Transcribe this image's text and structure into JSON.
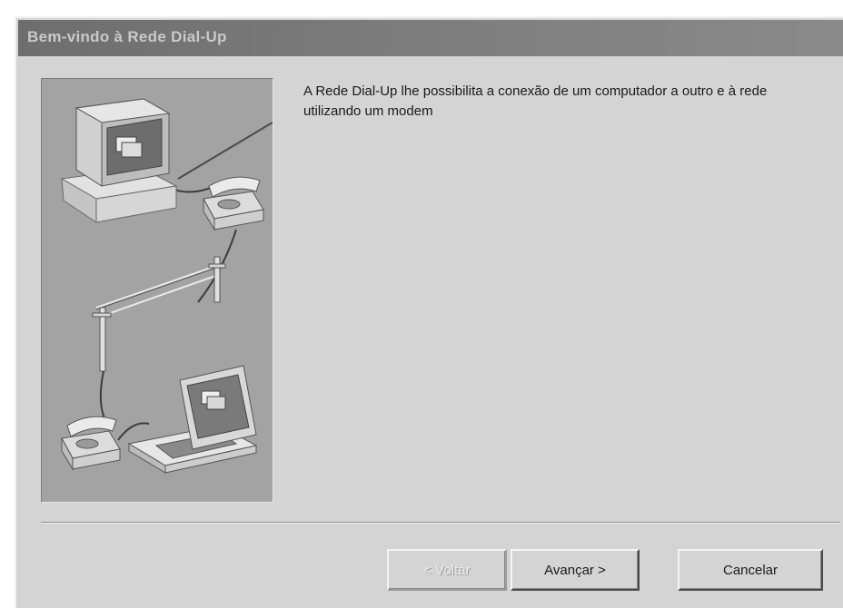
{
  "window": {
    "title": "Bem-vindo à Rede Dial-Up"
  },
  "content": {
    "description": "A Rede Dial-Up lhe possibilita a conexão de um computador a outro e à rede utilizando um modem",
    "illustration": {
      "icons": [
        "desktop-computer-icon",
        "telephone-icon",
        "telephone-pole-icon",
        "laptop-computer-icon"
      ]
    }
  },
  "buttons": {
    "back_label": "< Voltar",
    "next_label": "Avançar >",
    "cancel_label": "Cancelar",
    "back_enabled": false
  },
  "colors": {
    "dialog_background": "#d4d4d4",
    "titlebar": "#7a7a7a",
    "illustration_background": "#a3a3a3"
  }
}
